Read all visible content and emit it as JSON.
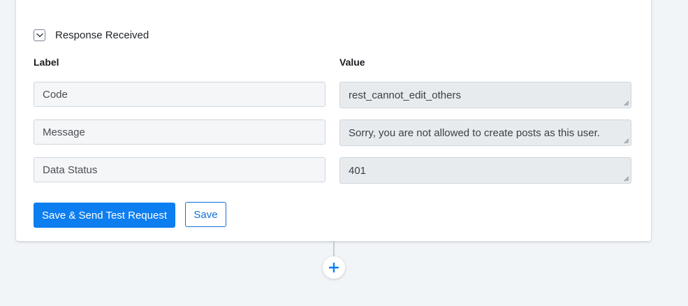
{
  "section": {
    "title": "Response Received",
    "expanded": true
  },
  "columns": {
    "label": "Label",
    "value": "Value"
  },
  "rows": [
    {
      "label": "Code",
      "value": "rest_cannot_edit_others"
    },
    {
      "label": "Message",
      "value": "Sorry, you are not allowed to create posts as this user."
    },
    {
      "label": "Data Status",
      "value": "401"
    }
  ],
  "buttons": {
    "send_test": "Save & Send Test Request",
    "save": "Save"
  },
  "icons": {
    "toggle": "chevron-down-icon",
    "add": "plus-icon"
  },
  "colors": {
    "primary": "#0d7ef0",
    "background": "#f2f5f8"
  }
}
